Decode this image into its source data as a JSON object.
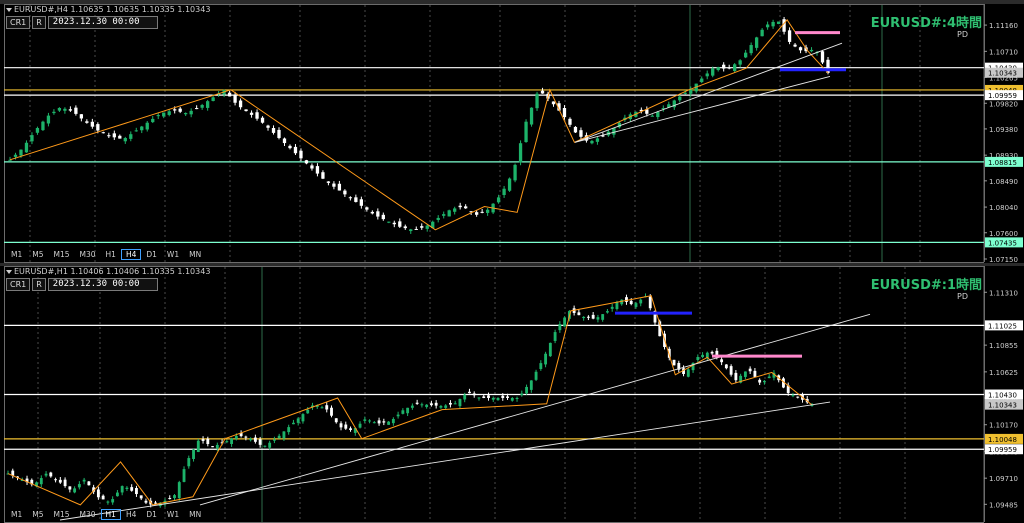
{
  "h4": {
    "info": "EURUSD#,H4  1.10635 1.10635 1.10335 1.10343",
    "buttons": [
      "CR1",
      "R"
    ],
    "date": "2023.12.30 00:00",
    "title": "EURUSD#:4時間",
    "sub": "PD",
    "timeframes": [
      "M1",
      "M5",
      "M15",
      "M30",
      "H1",
      "H4",
      "D1",
      "W1",
      "MN"
    ],
    "active_tf": "H4",
    "y_range": [
      1.0715,
      1.1135
    ],
    "ticks": [
      "1.11160",
      "1.10710",
      "1.10265",
      "1.09820",
      "1.09380",
      "1.08930",
      "1.08490",
      "1.08040",
      "1.07600",
      "1.07150"
    ],
    "levels": [
      {
        "price": 1.1043,
        "label": "1.10430",
        "color": "#ffffff"
      },
      {
        "price": 1.10048,
        "label": "1.10048",
        "color": "#f0c030"
      },
      {
        "price": 1.09959,
        "label": "1.09959",
        "color": "#ffffff"
      },
      {
        "price": 1.08815,
        "label": "1.08815",
        "color": "#7dffd0"
      },
      {
        "price": 1.07435,
        "label": "1.07435",
        "color": "#7dffd0"
      }
    ],
    "last_price": {
      "price": 1.10343,
      "label": "1.10343"
    },
    "colors": {
      "up": "#1db36a",
      "down": "#ffffff",
      "zigzag": "#ff9a1a"
    }
  },
  "h1": {
    "info": "EURUSD#,H1  1.10406 1.10406 1.10335 1.10343",
    "buttons": [
      "CR1",
      "R"
    ],
    "date": "2023.12.30 00:00",
    "title": "EURUSD#:1時間",
    "sub": "PD",
    "timeframes": [
      "M1",
      "M5",
      "M15",
      "M30",
      "H1",
      "H4",
      "D1",
      "W1",
      "MN"
    ],
    "active_tf": "H1",
    "y_range": [
      1.0935,
      1.1145
    ],
    "ticks": [
      "1.11310",
      "1.11025",
      "1.10855",
      "1.10625",
      "1.10400",
      "1.10170",
      "1.09940",
      "1.09710",
      "1.09485"
    ],
    "levels": [
      {
        "price": 1.11025,
        "label": "1.11025",
        "color": "#ffffff"
      },
      {
        "price": 1.1043,
        "label": "1.10430",
        "color": "#ffffff"
      },
      {
        "price": 1.10048,
        "label": "1.10048",
        "color": "#f0c030"
      },
      {
        "price": 1.09959,
        "label": "1.09959",
        "color": "#ffffff"
      }
    ],
    "last_price": {
      "price": 1.10343,
      "label": "1.10343"
    },
    "colors": {
      "up": "#1db36a",
      "down": "#ffffff",
      "zigzag": "#ff9a1a"
    }
  },
  "chart_data": [
    {
      "type": "candlestick",
      "symbol": "EURUSD#",
      "timeframe": "H4",
      "ylim": [
        1.0715,
        1.1135
      ],
      "close_path": [
        1.0885,
        1.0905,
        1.0935,
        1.096,
        1.0975,
        1.0968,
        1.095,
        1.0935,
        1.0925,
        1.092,
        1.0935,
        1.095,
        1.0965,
        1.097,
        1.0965,
        1.0975,
        1.099,
        1.1005,
        1.098,
        1.0965,
        1.095,
        1.093,
        1.091,
        1.089,
        1.087,
        1.085,
        1.0835,
        1.082,
        1.0805,
        1.079,
        1.078,
        1.077,
        1.0765,
        1.077,
        1.0785,
        1.08,
        1.0805,
        1.079,
        1.08,
        1.0825,
        1.0865,
        1.095,
        1.1005,
        1.0985,
        1.096,
        1.093,
        1.0915,
        1.0925,
        1.094,
        1.096,
        1.097,
        1.096,
        1.0975,
        1.099,
        1.1005,
        1.1025,
        1.1045,
        1.104,
        1.1055,
        1.1085,
        1.1115,
        1.1125,
        1.1085,
        1.107,
        1.1075,
        1.1034
      ]
    },
    {
      "type": "candlestick",
      "symbol": "EURUSD#",
      "timeframe": "H1",
      "ylim": [
        1.0935,
        1.1145
      ],
      "close_path": [
        1.0975,
        1.097,
        1.0965,
        1.0975,
        1.0968,
        1.096,
        1.097,
        1.0955,
        1.095,
        1.0965,
        1.0958,
        1.0948,
        1.095,
        1.0955,
        1.0985,
        1.1005,
        1.0998,
        1.1002,
        1.1008,
        1.1005,
        1.0998,
        1.1005,
        1.1015,
        1.1025,
        1.1035,
        1.103,
        1.1015,
        1.1012,
        1.1022,
        1.1018,
        1.102,
        1.103,
        1.1035,
        1.1034,
        1.1033,
        1.1035,
        1.1045,
        1.104,
        1.104,
        1.104,
        1.104,
        1.1055,
        1.1075,
        1.11,
        1.1115,
        1.111,
        1.1108,
        1.1115,
        1.1125,
        1.112,
        1.1128,
        1.1095,
        1.107,
        1.106,
        1.1075,
        1.108,
        1.107,
        1.1055,
        1.1065,
        1.1052,
        1.1062,
        1.1045,
        1.104,
        1.1034
      ]
    }
  ]
}
